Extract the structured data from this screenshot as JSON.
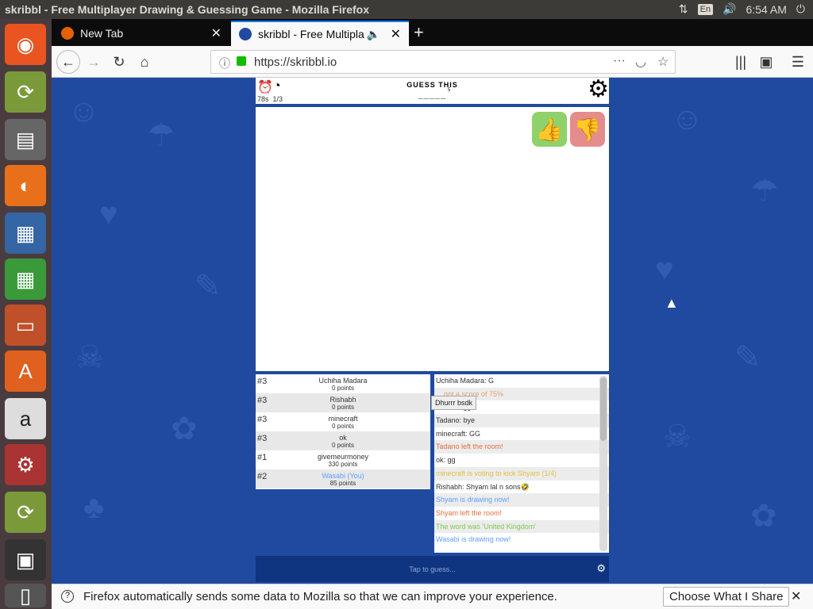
{
  "os": {
    "window_title": "skribbl - Free Multiplayer Drawing & Guessing Game - Mozilla Firefox",
    "keyboard": "En",
    "clock": "6:54 AM"
  },
  "tabs": [
    {
      "label": "New Tab"
    },
    {
      "label": "skribbl - Free Multipla"
    }
  ],
  "url": "https://skribbl.io",
  "game": {
    "timer": "78s",
    "round": "1/3",
    "prompt": "GUESS THIS",
    "blanks": "_____",
    "letter_count": "5",
    "players": [
      {
        "rank": "#3",
        "name": "Uchiha Madara",
        "points": "0 points"
      },
      {
        "rank": "#3",
        "name": "Rishabh",
        "points": "0 points"
      },
      {
        "rank": "#3",
        "name": "minecraft",
        "points": "0 points"
      },
      {
        "rank": "#3",
        "name": "ok",
        "points": "0 points"
      },
      {
        "rank": "#1",
        "name": "givemeurmoney",
        "points": "330 points"
      },
      {
        "rank": "#2",
        "name": "Wasabi (You)",
        "points": "85 points"
      }
    ],
    "chat": [
      {
        "text": "Uchiha Madara: G",
        "color": "#333333"
      },
      {
        "text": "... got a score of 75%",
        "color": "#e0a070"
      },
      {
        "text": "Tadano: gg",
        "color": "#333333"
      },
      {
        "text": "Tadano: bye",
        "color": "#333333"
      },
      {
        "text": "minecraft: GG",
        "color": "#333333"
      },
      {
        "text": "Tadano left the room!",
        "color": "#e07040"
      },
      {
        "text": "ok: gg",
        "color": "#333333"
      },
      {
        "text": "minecraft is voting to kick Shyam (1/4)",
        "color": "#e0c040"
      },
      {
        "text": "Rishabh: Shyam lal n sons🤣",
        "color": "#333333"
      },
      {
        "text": "Shyam is drawing now!",
        "color": "#5fa0ff"
      },
      {
        "text": "Shyam left the room!",
        "color": "#e07040"
      },
      {
        "text": "The word was 'United Kingdom'",
        "color": "#7ec850"
      },
      {
        "text": "Wasabi is drawing now!",
        "color": "#5fa0ff"
      }
    ],
    "tooltip": "Dhurrr bsdk",
    "guess_placeholder": "Tap to guess..."
  },
  "notification": {
    "text": "Firefox automatically sends some data to Mozilla so that we can improve your experience.",
    "button": "Choose What I Share"
  }
}
